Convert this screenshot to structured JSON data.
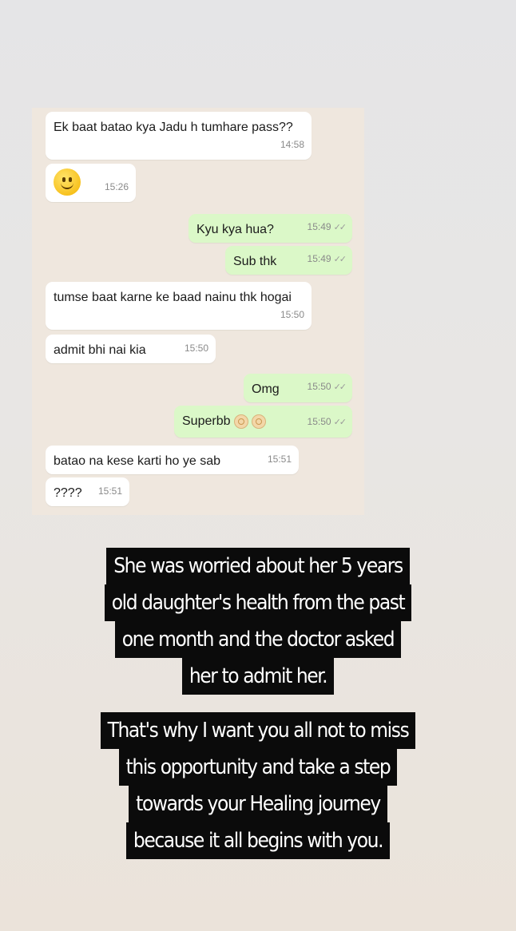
{
  "messages": [
    {
      "id": "m1",
      "side": "in",
      "text": "Ek baat batao kya Jadu h tumhare pass??",
      "time": "14:58"
    },
    {
      "id": "m2",
      "side": "in",
      "emoji": "slightly-smiling-face",
      "time": "15:26"
    },
    {
      "id": "m3",
      "side": "out",
      "text": "Kyu kya hua?",
      "time": "15:49",
      "status": "read"
    },
    {
      "id": "m4",
      "side": "out",
      "text": "Sub thk",
      "time": "15:49",
      "status": "read"
    },
    {
      "id": "m5",
      "side": "in",
      "text": "tumse baat karne ke baad nainu thk hogai",
      "time": "15:50"
    },
    {
      "id": "m6",
      "side": "in",
      "text": "admit bhi nai kia",
      "time": "15:50"
    },
    {
      "id": "m7",
      "side": "out",
      "text": "Omg",
      "time": "15:50",
      "status": "read"
    },
    {
      "id": "m8",
      "side": "out",
      "text": "Superbb",
      "emoji": "ok-hand x2",
      "time": "15:50",
      "status": "read"
    },
    {
      "id": "m9",
      "side": "in",
      "text": "batao na kese karti ho ye sab",
      "time": "15:51"
    },
    {
      "id": "m10",
      "side": "in",
      "text": "????",
      "time": "15:51"
    }
  ],
  "captions": {
    "first": [
      "She was worried about her 5 years",
      "old daughter's health from the past",
      "one month and the doctor asked",
      "her to admit her."
    ],
    "second": [
      "That's why I want you all not to miss",
      "this opportunity and take a step",
      "towards your Healing journey",
      "because it all begins with you."
    ]
  },
  "colors": {
    "incoming_bubble": "#ffffff",
    "outgoing_bubble": "#dbf8c8",
    "chat_background": "#efe7de",
    "caption_background": "#0b0b0b",
    "caption_text": "#ffffff"
  },
  "icons": {
    "read_receipt": "double-check-icon"
  }
}
